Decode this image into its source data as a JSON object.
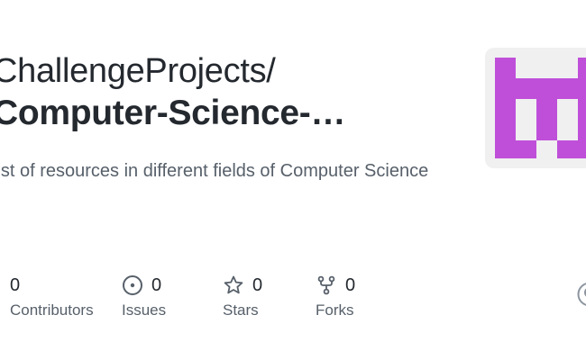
{
  "repo": {
    "owner": "ChallengeProjects/",
    "name": "Computer-Science-…",
    "description": "list of resources in different fields of Computer Science"
  },
  "stats": [
    {
      "value": "0",
      "label": "Contributors",
      "icon": "people-icon"
    },
    {
      "value": "0",
      "label": "Issues",
      "icon": "issue-icon"
    },
    {
      "value": "0",
      "label": "Stars",
      "icon": "star-icon"
    },
    {
      "value": "0",
      "label": "Forks",
      "icon": "fork-icon"
    }
  ],
  "colors": {
    "avatar_accent": "#bf4fd9",
    "avatar_bg": "#f0f0f0",
    "text_primary": "#24292f",
    "text_secondary": "#57606a"
  }
}
